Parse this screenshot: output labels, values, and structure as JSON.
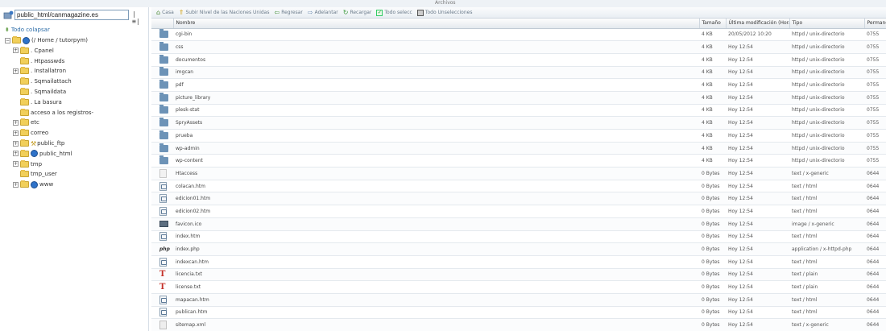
{
  "window": {
    "title_fragment": "Archivos"
  },
  "left_panel": {
    "path_value": "public_html/canmagazine.es",
    "go_label": "|≡|",
    "collapse_label": "Todo colapsar",
    "tree": [
      {
        "label": "(/ Home / tutorpym)",
        "expander": "⊟",
        "icon": "root"
      },
      {
        "label": ". Cpanel",
        "expander": "⊞",
        "icon": "folder"
      },
      {
        "label": ". Htpasswds",
        "expander": "",
        "icon": "folder"
      },
      {
        "label": ". Installatron",
        "expander": "⊞",
        "icon": "folder"
      },
      {
        "label": ". Sqmailattach",
        "expander": "",
        "icon": "folder"
      },
      {
        "label": ". Sqmaildata",
        "expander": "",
        "icon": "folder"
      },
      {
        "label": ". La basura",
        "expander": "",
        "icon": "folder"
      },
      {
        "label": "acceso a los registros-",
        "expander": "",
        "icon": "folder"
      },
      {
        "label": "etc",
        "expander": "⊞",
        "icon": "folder"
      },
      {
        "label": "correo",
        "expander": "⊞",
        "icon": "folder"
      },
      {
        "label": "public_ftp",
        "expander": "⊞",
        "icon": "folder-ftp"
      },
      {
        "label": "public_html",
        "expander": "⊞",
        "icon": "folder-globe"
      },
      {
        "label": "tmp",
        "expander": "⊞",
        "icon": "folder"
      },
      {
        "label": "tmp_user",
        "expander": "",
        "icon": "folder"
      },
      {
        "label": "www",
        "expander": "⊞",
        "icon": "folder-globe"
      }
    ]
  },
  "toolbar": {
    "home": "Casa",
    "up": "Subir Nivel de las Naciones Unidas",
    "back": "Regresar",
    "forward": "Adelantar",
    "reload": "Recargar",
    "select_all": "Todo selecc",
    "unselect_all": "Todo Unselecciones"
  },
  "columns": {
    "name": "Nombre",
    "size": "Tamaño",
    "modified": "Última modificación (Hora",
    "type": "Tipo",
    "perms": "Permane"
  },
  "files": [
    {
      "name": "cgi-bin",
      "size": "4 KB",
      "modified": "20/05/2012 10:20",
      "type": "httpd / unix-directorio",
      "perms": "0755",
      "icon": "folder"
    },
    {
      "name": "css",
      "size": "4 KB",
      "modified": "Hoy 12:54",
      "type": "httpd / unix-directorio",
      "perms": "0755",
      "icon": "folder"
    },
    {
      "name": "documentos",
      "size": "4 KB",
      "modified": "Hoy 12:54",
      "type": "httpd / unix-directorio",
      "perms": "0755",
      "icon": "folder"
    },
    {
      "name": "imgcan",
      "size": "4 KB",
      "modified": "Hoy 12:54",
      "type": "httpd / unix-directorio",
      "perms": "0755",
      "icon": "folder"
    },
    {
      "name": "pdf",
      "size": "4 KB",
      "modified": "Hoy 12:54",
      "type": "httpd / unix-directorio",
      "perms": "0755",
      "icon": "folder"
    },
    {
      "name": "picture_library",
      "size": "4 KB",
      "modified": "Hoy 12:54",
      "type": "httpd / unix-directorio",
      "perms": "0755",
      "icon": "folder"
    },
    {
      "name": "plesk-stat",
      "size": "4 KB",
      "modified": "Hoy 12:54",
      "type": "httpd / unix-directorio",
      "perms": "0755",
      "icon": "folder"
    },
    {
      "name": "SpryAssets",
      "size": "4 KB",
      "modified": "Hoy 12:54",
      "type": "httpd / unix-directorio",
      "perms": "0755",
      "icon": "folder"
    },
    {
      "name": "prueba",
      "size": "4 KB",
      "modified": "Hoy 12:54",
      "type": "httpd / unix-directorio",
      "perms": "0755",
      "icon": "folder"
    },
    {
      "name": "wp-admin",
      "size": "4 KB",
      "modified": "Hoy 12:54",
      "type": "httpd / unix-directorio",
      "perms": "0755",
      "icon": "folder"
    },
    {
      "name": "wp-content",
      "size": "4 KB",
      "modified": "Hoy 12:54",
      "type": "httpd / unix-directorio",
      "perms": "0755",
      "icon": "folder"
    },
    {
      "name": "Htaccess",
      "size": "0 Bytes",
      "modified": "Hoy 12:54",
      "type": "text / x-generic",
      "perms": "0644",
      "icon": "file"
    },
    {
      "name": "colacan.htm",
      "size": "0 Bytes",
      "modified": "Hoy 12:54",
      "type": "text / html",
      "perms": "0644",
      "icon": "html"
    },
    {
      "name": "edicion01.htm",
      "size": "0 Bytes",
      "modified": "Hoy 12:54",
      "type": "text / html",
      "perms": "0644",
      "icon": "html"
    },
    {
      "name": "edicion02.htm",
      "size": "0 Bytes",
      "modified": "Hoy 12:54",
      "type": "text / html",
      "perms": "0644",
      "icon": "html"
    },
    {
      "name": "favicon.ico",
      "size": "0 Bytes",
      "modified": "Hoy 12:54",
      "type": "image / x-generic",
      "perms": "0644",
      "icon": "ico"
    },
    {
      "name": "index.htm",
      "size": "0 Bytes",
      "modified": "Hoy 12:54",
      "type": "text / html",
      "perms": "0644",
      "icon": "html"
    },
    {
      "name": "index.php",
      "size": "0 Bytes",
      "modified": "Hoy 12:54",
      "type": "application / x-httpd-php",
      "perms": "0644",
      "icon": "php"
    },
    {
      "name": "indexcan.htm",
      "size": "0 Bytes",
      "modified": "Hoy 12:54",
      "type": "text / html",
      "perms": "0644",
      "icon": "html"
    },
    {
      "name": "licencia.txt",
      "size": "0 Bytes",
      "modified": "Hoy 12:54",
      "type": "text / plain",
      "perms": "0644",
      "icon": "txt"
    },
    {
      "name": "license.txt",
      "size": "0 Bytes",
      "modified": "Hoy 12:54",
      "type": "text / plain",
      "perms": "0644",
      "icon": "txt"
    },
    {
      "name": "mapacan.htm",
      "size": "0 Bytes",
      "modified": "Hoy 12:54",
      "type": "text / html",
      "perms": "0644",
      "icon": "html"
    },
    {
      "name": "publican.htm",
      "size": "0 Bytes",
      "modified": "Hoy 12:54",
      "type": "text / html",
      "perms": "0644",
      "icon": "html"
    },
    {
      "name": "sitemap.xml",
      "size": "0 Bytes",
      "modified": "Hoy 12:54",
      "type": "text / x-generic",
      "perms": "0644",
      "icon": "xml"
    }
  ]
}
